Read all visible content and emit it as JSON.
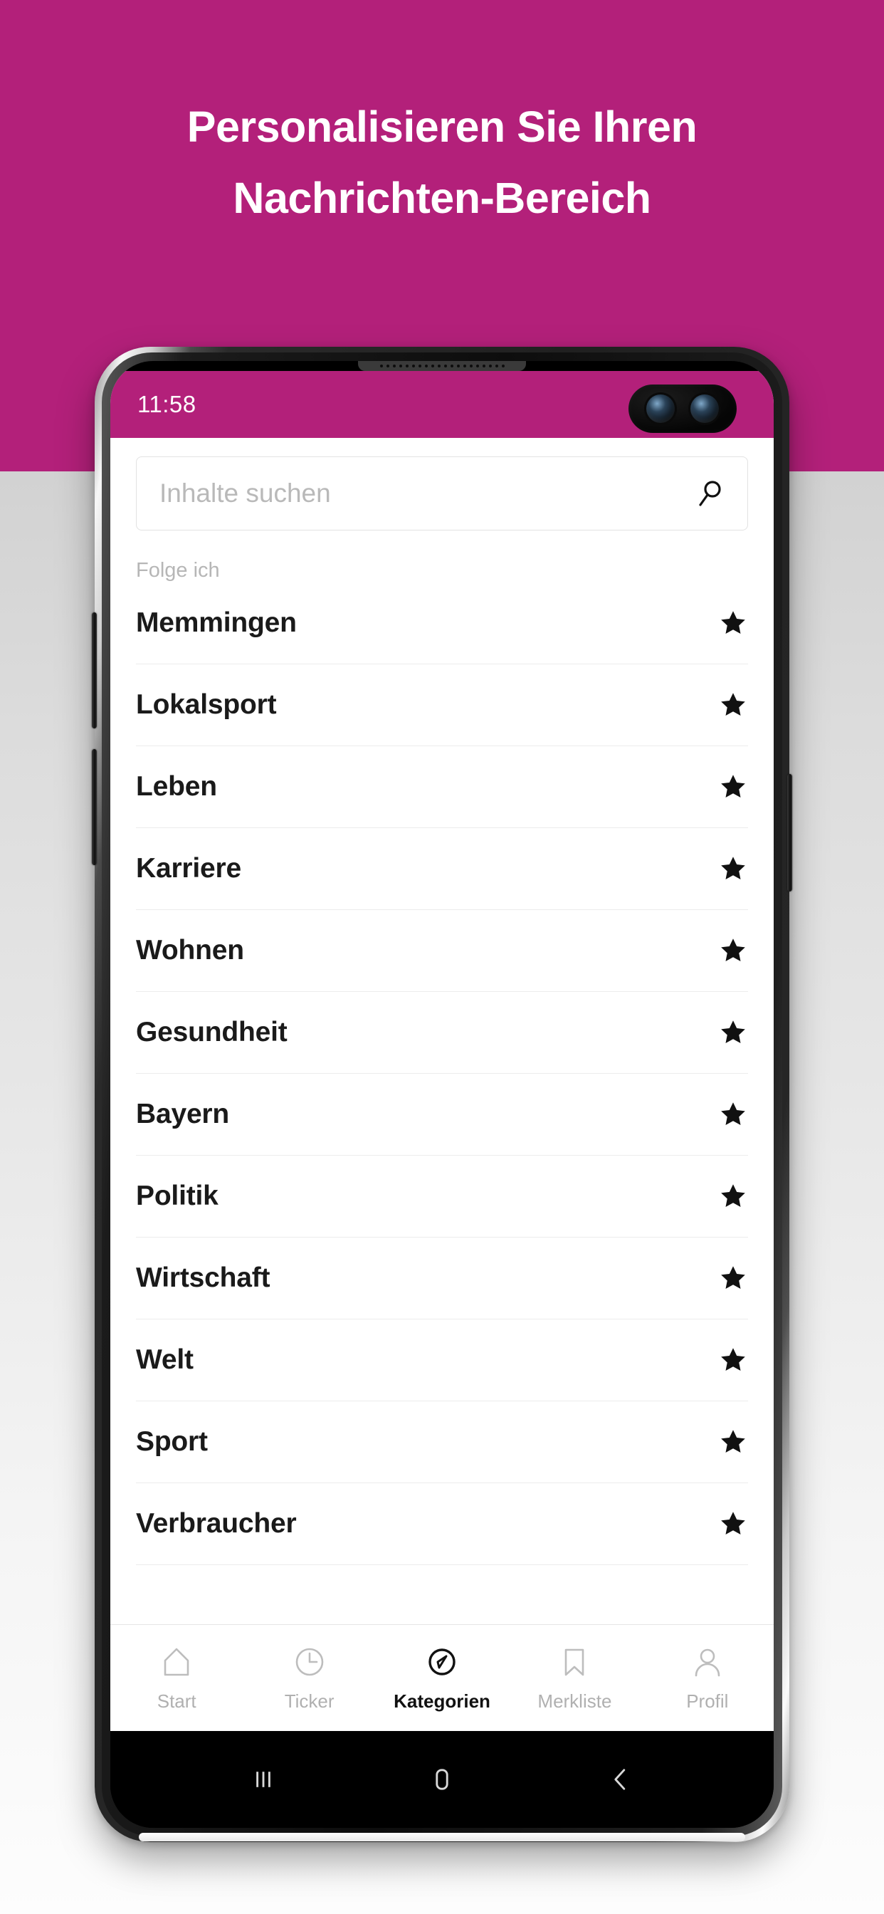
{
  "promo": {
    "headline_line1": "Personalisieren Sie Ihren",
    "headline_line2": "Nachrichten-Bereich",
    "background_color": "#b3207a",
    "text_color": "#ffffff"
  },
  "statusbar": {
    "time": "11:58",
    "background_color": "#b3207a"
  },
  "search": {
    "placeholder": "Inhalte suchen",
    "value": "",
    "icon": "search-icon"
  },
  "section": {
    "label": "Folge ich"
  },
  "categories": [
    {
      "label": "Memmingen",
      "followed": true,
      "icon": "star-filled-icon"
    },
    {
      "label": "Lokalsport",
      "followed": true,
      "icon": "star-filled-icon"
    },
    {
      "label": "Leben",
      "followed": true,
      "icon": "star-filled-icon"
    },
    {
      "label": "Karriere",
      "followed": true,
      "icon": "star-filled-icon"
    },
    {
      "label": "Wohnen",
      "followed": true,
      "icon": "star-filled-icon"
    },
    {
      "label": "Gesundheit",
      "followed": true,
      "icon": "star-filled-icon"
    },
    {
      "label": "Bayern",
      "followed": true,
      "icon": "star-filled-icon"
    },
    {
      "label": "Politik",
      "followed": true,
      "icon": "star-filled-icon"
    },
    {
      "label": "Wirtschaft",
      "followed": true,
      "icon": "star-filled-icon"
    },
    {
      "label": "Welt",
      "followed": true,
      "icon": "star-filled-icon"
    },
    {
      "label": "Sport",
      "followed": true,
      "icon": "star-filled-icon"
    },
    {
      "label": "Verbraucher",
      "followed": true,
      "icon": "star-filled-icon"
    }
  ],
  "tabbar": {
    "active_color": "#111111",
    "inactive_color": "#b0b0b0",
    "tabs": [
      {
        "label": "Start",
        "icon": "home-icon",
        "active": false
      },
      {
        "label": "Ticker",
        "icon": "clock-icon",
        "active": false
      },
      {
        "label": "Kategorien",
        "icon": "compass-icon",
        "active": true
      },
      {
        "label": "Merkliste",
        "icon": "bookmark-icon",
        "active": false
      },
      {
        "label": "Profil",
        "icon": "person-icon",
        "active": false
      }
    ]
  },
  "android_nav": {
    "recents": "recents-icon",
    "home": "home-square-icon",
    "back": "back-chevron-icon"
  }
}
